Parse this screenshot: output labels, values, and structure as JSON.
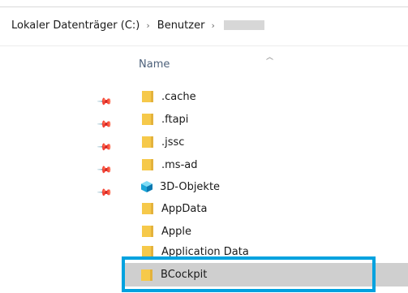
{
  "breadcrumb": {
    "items": [
      "Lokaler Datenträger (C:)",
      "Benutzer"
    ],
    "separator": "›",
    "redacted_item": true
  },
  "column_header": {
    "name_label": "Name",
    "sort_icon": "chevron-up-icon"
  },
  "items": [
    {
      "label": ".cache",
      "icon": "folder-icon",
      "pinned": true
    },
    {
      "label": ".ftapi",
      "icon": "folder-icon",
      "pinned": true
    },
    {
      "label": ".jssc",
      "icon": "folder-icon",
      "pinned": true
    },
    {
      "label": ".ms-ad",
      "icon": "folder-icon",
      "pinned": true
    },
    {
      "label": "3D-Objekte",
      "icon": "3d-objects-icon",
      "pinned": true
    },
    {
      "label": "AppData",
      "icon": "folder-icon",
      "pinned": false
    },
    {
      "label": "Apple",
      "icon": "folder-icon",
      "pinned": false
    },
    {
      "label": "Application Data",
      "icon": "folder-icon",
      "pinned": false
    },
    {
      "label": "BCockpit",
      "icon": "folder-icon",
      "pinned": false,
      "selected": true
    }
  ],
  "colors": {
    "highlight_border": "#00a2df",
    "selection_bg": "#cfcfcf",
    "folder": "#f6c94a"
  }
}
